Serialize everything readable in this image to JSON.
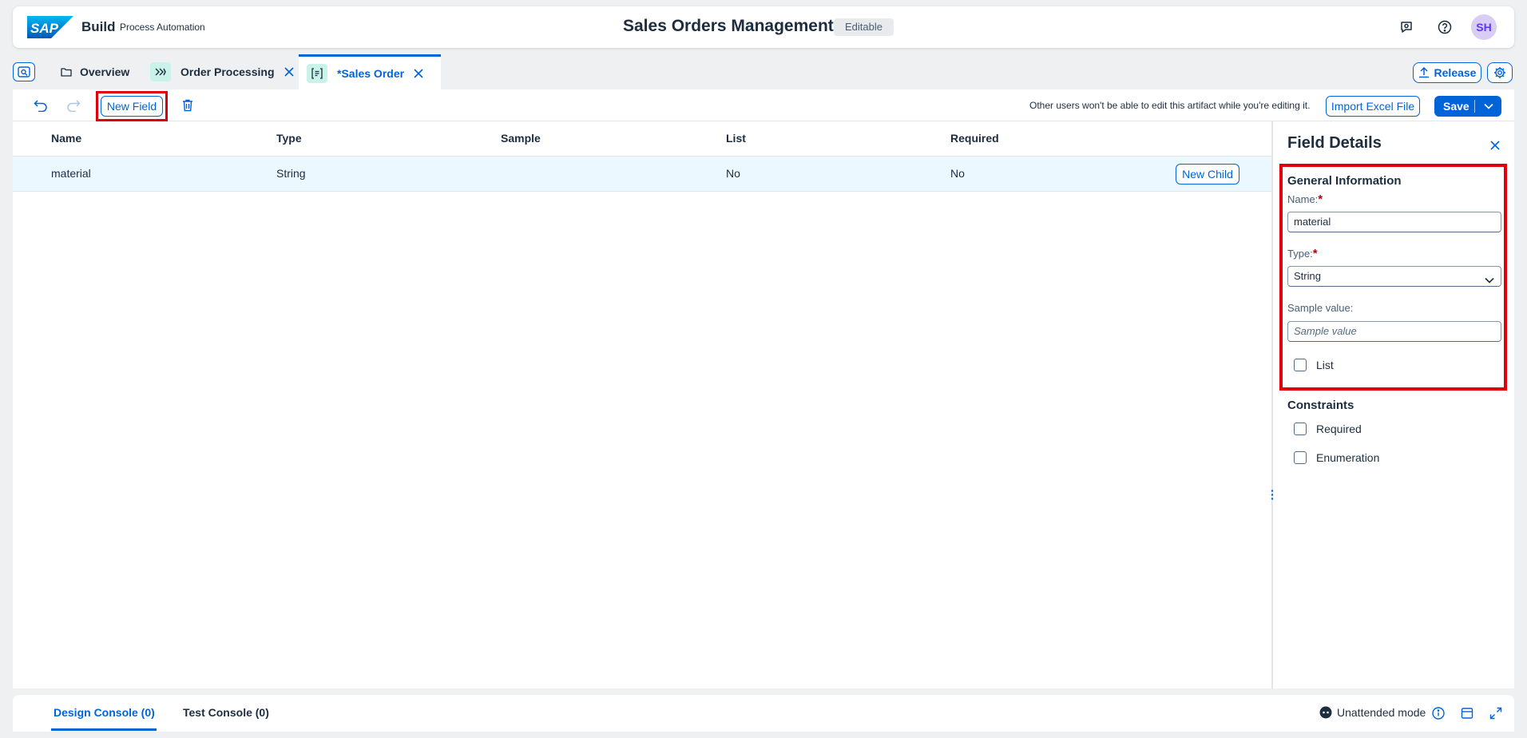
{
  "shell": {
    "logo_text": "SAP",
    "brand": "Build",
    "brand_sub": "Process Automation",
    "title": "Sales Orders Management",
    "badge": "Editable",
    "avatar": "SH"
  },
  "tabs": [
    {
      "label": "Overview",
      "icon": "folder-icon"
    },
    {
      "label": "Order Processing",
      "icon": "process-icon",
      "closable": true
    },
    {
      "label": "*Sales Order",
      "icon": "data-type-icon",
      "closable": true,
      "active": true
    }
  ],
  "tabbar": {
    "release": "Release"
  },
  "toolbar": {
    "new_field": "New Field",
    "lock_message": "Other users won't be able to edit this artifact while you're editing it.",
    "import": "Import Excel File",
    "save": "Save"
  },
  "table": {
    "columns": [
      "Name",
      "Type",
      "Sample",
      "List",
      "Required"
    ],
    "rows": [
      {
        "name": "material",
        "type": "String",
        "sample": "",
        "list": "No",
        "required": "No",
        "action": "New Child"
      }
    ]
  },
  "details": {
    "title": "Field Details",
    "general_title": "General Information",
    "name_label": "Name:",
    "name_value": "material",
    "type_label": "Type:",
    "type_value": "String",
    "sample_label": "Sample value:",
    "sample_placeholder": "Sample value",
    "list_label": "List",
    "constraints_title": "Constraints",
    "required_label": "Required",
    "enumeration_label": "Enumeration",
    "required_star": "*"
  },
  "console": {
    "design": "Design Console (0)",
    "test": "Test Console (0)",
    "mode": "Unattended mode"
  },
  "colors": {
    "accent": "#0064d9",
    "highlight": "#e0000a",
    "selected_row": "#ebf8ff"
  }
}
